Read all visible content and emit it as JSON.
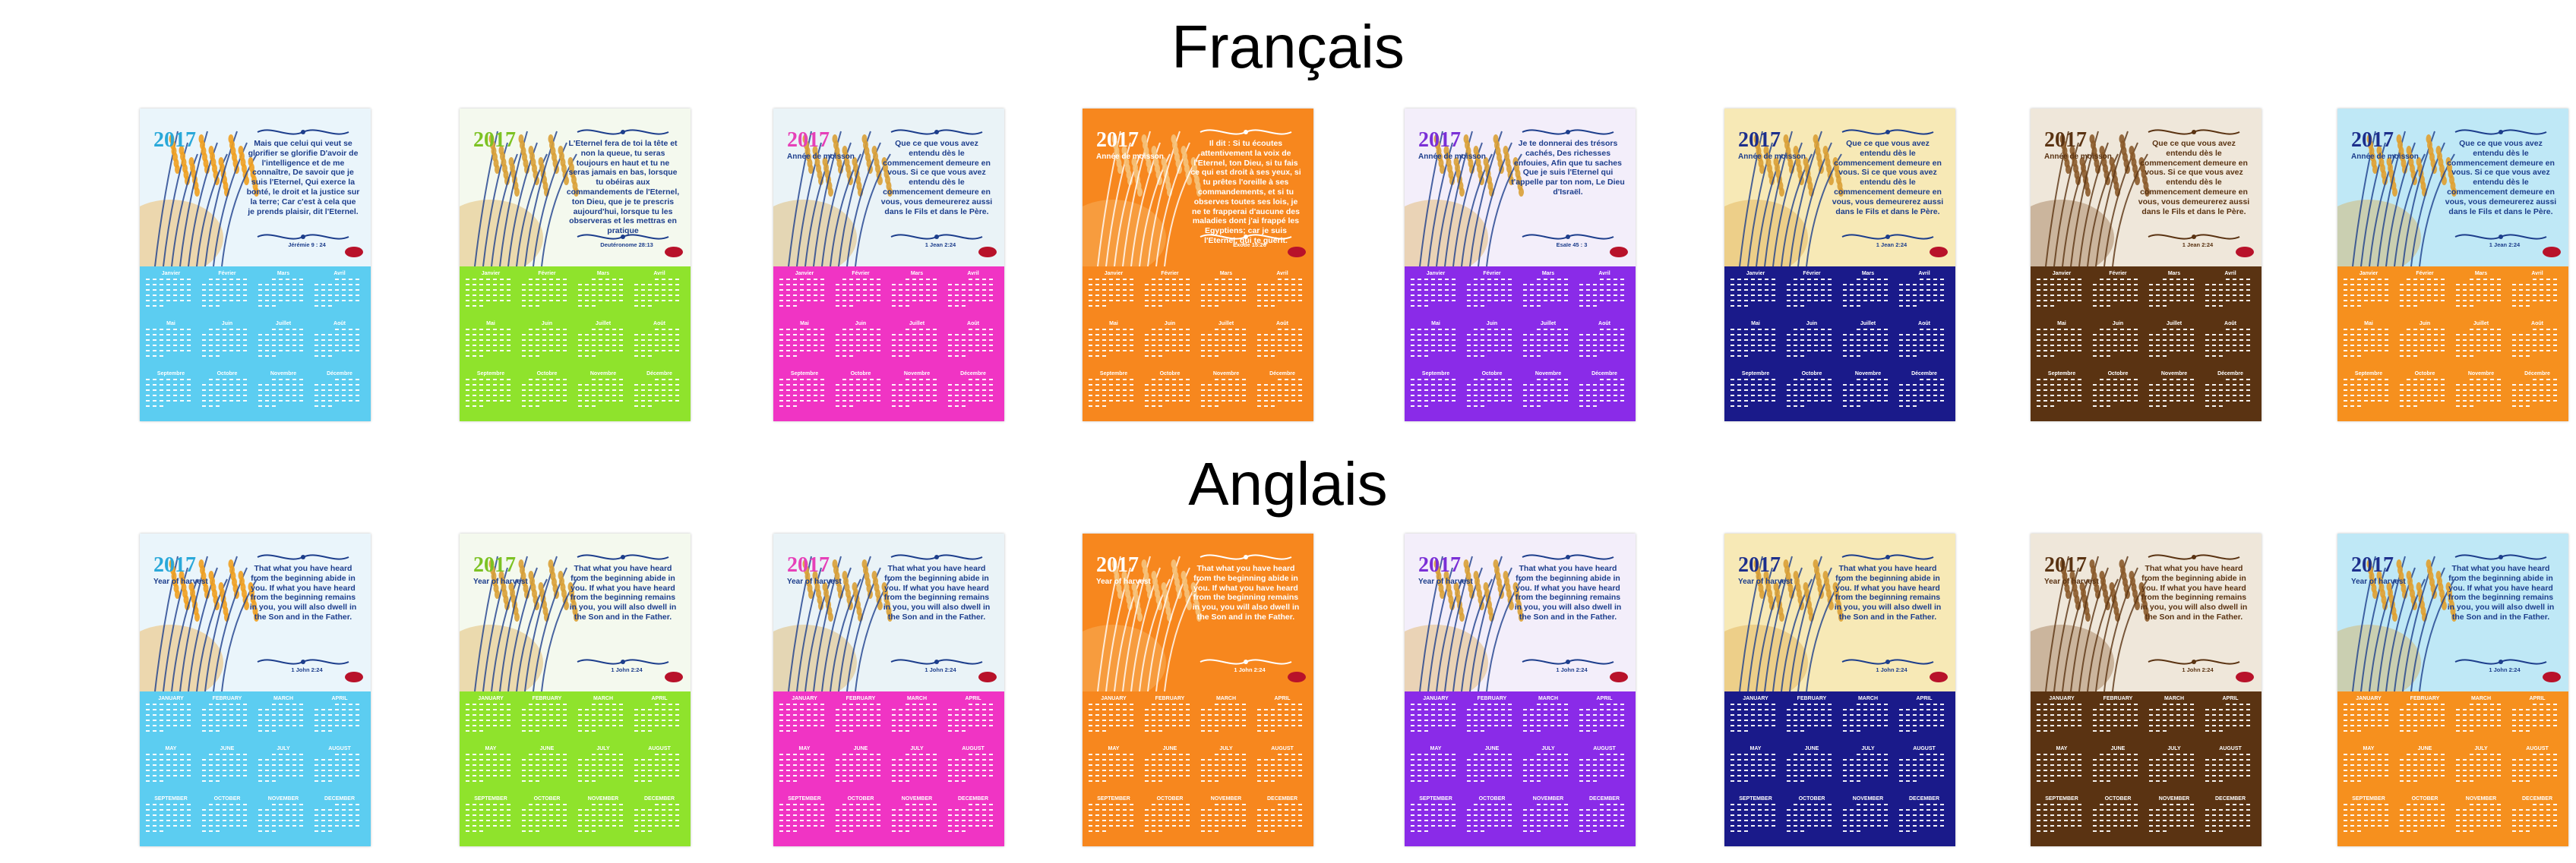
{
  "sections": [
    {
      "title": "Français",
      "month_names": [
        "Janvier",
        "Février",
        "Mars",
        "Avril",
        "Mai",
        "Juin",
        "Juillet",
        "Août",
        "Septembre",
        "Octobre",
        "Novembre",
        "Décembre"
      ],
      "cards": [
        {
          "year": "2017",
          "subtitle": "",
          "verse": "Mais que celui qui veut se glorifier se glorifie D'avoir de l'intelligence et de me connaître, De savoir que je suis l'Eternel, Qui exerce la bonté, le droit et la justice sur la terre; Car c'est à cela que je prends plaisir, dit l'Eternel.",
          "ref": "Jérémie 9 : 24",
          "calendar_color": "#5ccdf1",
          "top_bg": "#eaf5fb",
          "year_color": "#29a8d9",
          "verse_color": "#1d3e8c",
          "accent": "#f0a020"
        },
        {
          "year": "2017",
          "subtitle": "",
          "verse": "L'Eternel fera de toi la tête et non la queue, tu seras toujours en haut et tu ne seras jamais en bas, lorsque tu obéiras aux commandements de l'Eternel, ton Dieu, que je te prescris aujourd'hui, lorsque tu les observeras et les mettras en pratique",
          "ref": "Deutéronome 28:13",
          "calendar_color": "#8fe32c",
          "top_bg": "#f4f9ee",
          "year_color": "#7cc223",
          "verse_color": "#1d3e8c",
          "accent": "#d9a036"
        },
        {
          "year": "2017",
          "subtitle": "Année de moisson",
          "verse": "Que ce que vous avez entendu dès le commencement demeure en vous. Si ce que vous avez entendu dès le commencement demeure en vous, vous demeurerez aussi dans le Fils et dans le Père.",
          "ref": "1 Jean 2:24",
          "calendar_color": "#f034c4",
          "top_bg": "#eaf3f7",
          "year_color": "#e640b8",
          "verse_color": "#1d3e8c",
          "accent": "#d9a036"
        },
        {
          "year": "2017",
          "subtitle": "Année de moisson",
          "verse": "Il dit : Si tu écoutes attentivement la voix de l'Eternel, ton Dieu, si tu fais ce qui est droit à ses yeux, si tu prêtes l'oreille à ses commandements, et si tu observes toutes ses lois, je ne te frapperai d'aucune des maladies dont j'ai frappé les Egyptiens; car je suis l'Eternel, qui te guérit.",
          "ref": "Exode 15:26",
          "calendar_color": "#f7871e",
          "top_bg": "#f7871e",
          "year_color": "#ffffff",
          "verse_color": "#ffffff",
          "accent": "#f5c27a"
        },
        {
          "year": "2017",
          "subtitle": "Année de moisson",
          "verse": "Je te donnerai des trésors cachés, Des richesses enfouies, Afin que tu saches Que je suis l'Eternel qui t'appelle par ton nom, Le Dieu d'Israël.",
          "ref": "Esaïe 45 : 3",
          "calendar_color": "#8a2be8",
          "top_bg": "#f3eefa",
          "year_color": "#7a2fd6",
          "verse_color": "#1d3e8c",
          "accent": "#d9a036"
        },
        {
          "year": "2017",
          "subtitle": "Année de moisson",
          "verse": "Que ce que vous avez entendu dès le commencement demeure en vous. Si ce que vous avez entendu dès le commencement demeure en vous, vous demeurerez aussi dans le Fils et dans le Père.",
          "ref": "1 Jean 2:24",
          "calendar_color": "#1a1a8a",
          "top_bg": "#f7e9b6",
          "year_color": "#1d2f8c",
          "verse_color": "#1d3e8c",
          "accent": "#d9a036"
        },
        {
          "year": "2017",
          "subtitle": "Année de moisson",
          "verse": "Que ce que vous avez entendu dès le commencement demeure en vous. Si ce que vous avez entendu dès le commencement demeure en vous, vous demeurerez aussi dans le Fils et dans le Père.",
          "ref": "1 Jean 2:24",
          "calendar_color": "#5a3312",
          "top_bg": "#efe7da",
          "year_color": "#5a3312",
          "verse_color": "#5a3312",
          "accent": "#8a5a2a"
        },
        {
          "year": "2017",
          "subtitle": "Année de moisson",
          "verse": "Que ce que vous avez entendu dès le commencement demeure en vous. Si ce que vous avez entendu dès le commencement demeure en vous, vous demeurerez aussi dans le Fils et dans le Père.",
          "ref": "1 Jean 2:24",
          "calendar_color": "#f6901e",
          "top_bg": "#bfe8f6",
          "year_color": "#1d2f8c",
          "verse_color": "#1d3e8c",
          "accent": "#e0a030"
        }
      ]
    },
    {
      "title": "Anglais",
      "month_names": [
        "JANUARY",
        "FEBRUARY",
        "MARCH",
        "APRIL",
        "MAY",
        "JUNE",
        "JULY",
        "AUGUST",
        "SEPTEMBER",
        "OCTOBER",
        "NOVEMBER",
        "DECEMBER"
      ],
      "cards": [
        {
          "year": "2017",
          "subtitle": "Year of harvest",
          "verse": "That what you have heard from the beginning abide in you. If what you have heard from the beginning remains in you, you will also dwell in the Son and in the Father.",
          "ref": "1 John 2:24",
          "calendar_color": "#5ccdf1",
          "top_bg": "#eaf5fb",
          "year_color": "#29a8d9",
          "verse_color": "#1d3e8c",
          "accent": "#f0a020"
        },
        {
          "year": "2017",
          "subtitle": "Year of harvest",
          "verse": "That what you have heard from the beginning abide in you. If what you have heard from the beginning remains in you, you will also dwell in the Son and in the Father.",
          "ref": "1 John 2:24",
          "calendar_color": "#8fe32c",
          "top_bg": "#f4f9ee",
          "year_color": "#7cc223",
          "verse_color": "#1d3e8c",
          "accent": "#d9a036"
        },
        {
          "year": "2017",
          "subtitle": "Year of harvest",
          "verse": "That what you have heard from the beginning abide in you. If what you have heard from the beginning remains in you, you will also dwell in the Son and in the Father.",
          "ref": "1 John 2:24",
          "calendar_color": "#f034c4",
          "top_bg": "#eaf3f7",
          "year_color": "#e640b8",
          "verse_color": "#1d3e8c",
          "accent": "#d9a036"
        },
        {
          "year": "2017",
          "subtitle": "Year of harvest",
          "verse": "That what you have heard from the beginning abide in you. If what you have heard from the beginning remains in you, you will also dwell in the Son and in the Father.",
          "ref": "1 John 2:24",
          "calendar_color": "#f7871e",
          "top_bg": "#f7871e",
          "year_color": "#ffffff",
          "verse_color": "#ffffff",
          "accent": "#f5c27a"
        },
        {
          "year": "2017",
          "subtitle": "Year of harvest",
          "verse": "That what you have heard from the beginning abide in you. If what you have heard from the beginning remains in you, you will also dwell in the Son and in the Father.",
          "ref": "1 John 2:24",
          "calendar_color": "#8a2be8",
          "top_bg": "#f3eefa",
          "year_color": "#7a2fd6",
          "verse_color": "#1d3e8c",
          "accent": "#d9a036"
        },
        {
          "year": "2017",
          "subtitle": "Year of harvest",
          "verse": "That what you have heard from the beginning abide in you. If what you have heard from the beginning remains in you, you will also dwell in the Son and in the Father.",
          "ref": "1 John 2:24",
          "calendar_color": "#1a1a8a",
          "top_bg": "#f7e9b6",
          "year_color": "#1d2f8c",
          "verse_color": "#1d3e8c",
          "accent": "#d9a036"
        },
        {
          "year": "2017",
          "subtitle": "Year of harvest",
          "verse": "That what you have heard from the beginning abide in you. If what you have heard from the beginning remains in you, you will also dwell in the Son and in the Father.",
          "ref": "1 John 2:24",
          "calendar_color": "#5a3312",
          "top_bg": "#efe7da",
          "year_color": "#5a3312",
          "verse_color": "#5a3312",
          "accent": "#8a5a2a"
        },
        {
          "year": "2017",
          "subtitle": "Year of harvest",
          "verse": "That what you have heard from the beginning abide in you. If what you have heard from the beginning remains in you, you will also dwell in the Son and in the Father.",
          "ref": "1 John 2:24",
          "calendar_color": "#f6901e",
          "top_bg": "#bfe8f6",
          "year_color": "#1d2f8c",
          "verse_color": "#1d3e8c",
          "accent": "#e0a030"
        }
      ]
    }
  ]
}
